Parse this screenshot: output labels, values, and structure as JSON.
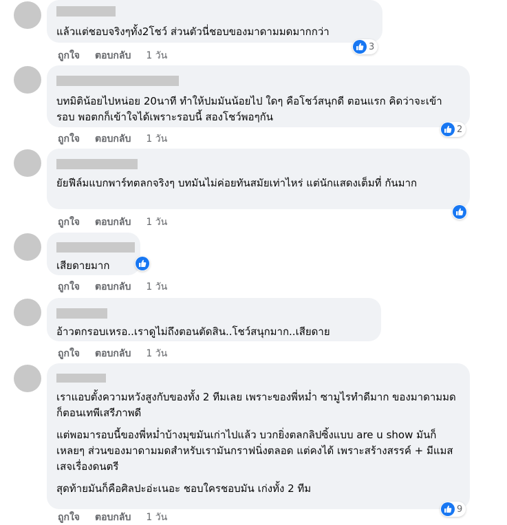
{
  "actions": {
    "like": "ถูกใจ",
    "reply": "ตอบกลับ",
    "time": "1 วัน"
  },
  "colors": {
    "like_blue": "#1877f2",
    "bubble": "#f0f2f5",
    "meta": "#65676b"
  },
  "comments": [
    {
      "paragraphs": [
        "แล้วแต่ชอบจริงๆทั้ง2โชว์ ส่วนตัวนี่ชอบของมาดามมดมากกว่า"
      ],
      "reactions": "3"
    },
    {
      "paragraphs": [
        "บทมิติน้อยไปหน่อย 20นาที ทำให้ปมมันน้อยไป ใดๆ คือโชว์สนุกดี ตอนแรก คิดว่าจะเข้ารอบ พอตกก็เข้าใจได้เพราะรอบนี้ สองโชว์พอๆกัน"
      ],
      "reactions": "2"
    },
    {
      "paragraphs": [
        "ยัยฟีล์มแบกพาร์ทตลกจริงๆ บทมันไม่ค่อยทันสมัยเท่าไหร่ แต่นักแสดงเต็มที่ กันมาก"
      ],
      "reactions": ""
    },
    {
      "paragraphs": [
        "เสียดายมาก"
      ],
      "reactions": ""
    },
    {
      "paragraphs": [
        "อ้าวตกรอบเหรอ..เราดูไม่ถึงตอนตัดสิน..โชว์สนุกมาก..เสียดาย"
      ],
      "reactions": ""
    },
    {
      "paragraphs": [
        "เราแอบตั้งความหวังสูงกับของทั้ง 2 ทีมเลย เพราะของพี่หม่ำ ซามูไรทำดีมาก ของมาดามมดก็ตอนเทพีเสรีภาพดี",
        "แต่พอมารอบนี้ของพี่หม่ำบ้างมุขมันเก่าไปแล้ว บวกยิ่งตลกลิปซิ้งแบบ are u show มันก็เหลยๆ ส่วนของมาดามมดสำหรับเรามันกราฟนิ่งตลอด แต่คงได้ เพราะสร้างสรรค์ + มีแมสเสจเรื่องดนตรี",
        "สุดท้ายมันก็คือศิลปะอ่ะเนอะ ชอบใครชอบมัน เก่งทั้ง 2 ทีม"
      ],
      "reactions": "9"
    }
  ]
}
